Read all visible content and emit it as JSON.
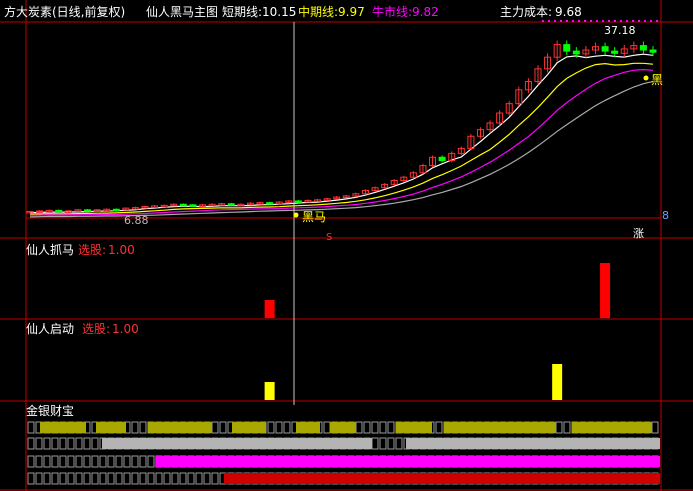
{
  "header": {
    "title": "方大炭素(日线,前复权)",
    "indicator": "仙人黑马主图",
    "short_label": "短期线:",
    "short_value": "10.15",
    "mid_label": "中期线:",
    "mid_value": "9.97",
    "bull_label": "牛市线:",
    "bull_value": "9.82",
    "main_cost_label": "主力成本:",
    "main_cost_value": "9.68"
  },
  "main_panel": {
    "high_label": "37.18",
    "low_label": "6.88",
    "marker_heima_cursor": "黑马",
    "marker_heima_right": "黑",
    "marker_s": "S",
    "marker_zhang": "涨",
    "right_value": "8"
  },
  "panel_zhuama": {
    "name": "仙人抓马",
    "signal_label": "选股:",
    "signal_value": "1.00"
  },
  "panel_qidong": {
    "name": "仙人启动",
    "signal_label": "选股:",
    "signal_value": "1.00"
  },
  "panel_jinyin": {
    "name": "金银财宝"
  },
  "colors": {
    "background": "#000000",
    "up_candle": "#ff3232",
    "down_candle": "#00ff00",
    "short_line": "#ffffff",
    "mid_line": "#ffff00",
    "bull_line": "#ff00ff",
    "cost_line": "#aaaaaa",
    "frame": "#c00000",
    "zhuama_bar": "#ff0000",
    "qidong_bar": "#ffff00",
    "gold_strip": "#a8a800",
    "silver_strip": "#b4b4b4",
    "magenta_strip": "#ff00ff",
    "red_strip": "#d00000"
  },
  "chart_data": [
    {
      "type": "line",
      "title": "仙人黑马主图",
      "series": [
        {
          "name": "短期线",
          "color": "#ffffff",
          "last": 10.15
        },
        {
          "name": "中期线",
          "color": "#ffff00",
          "last": 9.97
        },
        {
          "name": "牛市线",
          "color": "#ff00ff",
          "last": 9.82
        },
        {
          "name": "主力成本",
          "color": "#aaaaaa",
          "last": 9.68
        }
      ],
      "x": [
        0,
        2,
        4,
        6,
        8,
        10,
        12,
        14,
        16,
        18,
        20,
        22,
        24,
        26,
        28,
        30,
        32,
        34,
        36,
        38,
        40,
        42,
        44,
        46,
        48,
        50,
        52,
        54,
        56,
        58,
        60,
        62,
        64,
        66,
        68,
        70,
        72,
        74,
        76,
        78,
        80,
        82,
        84,
        86,
        88,
        90,
        92,
        94,
        96,
        98,
        100,
        102,
        104,
        106,
        108,
        110,
        112,
        114,
        116,
        118,
        120,
        122,
        124,
        126,
        128,
        130
      ],
      "close": [
        7.0,
        7.1,
        7.2,
        7.0,
        7.1,
        7.3,
        7.2,
        7.3,
        7.4,
        7.3,
        7.6,
        7.7,
        7.9,
        8.0,
        8.1,
        8.3,
        8.2,
        8.0,
        8.2,
        8.3,
        8.4,
        8.2,
        8.3,
        8.5,
        8.6,
        8.4,
        8.7,
        8.9,
        8.8,
        9.0,
        9.1,
        9.3,
        9.6,
        9.8,
        10.2,
        10.8,
        11.3,
        11.9,
        12.6,
        13.2,
        14.0,
        15.3,
        16.8,
        16.2,
        17.5,
        18.4,
        20.6,
        21.8,
        23.0,
        24.8,
        26.5,
        29.0,
        30.5,
        32.8,
        34.9,
        37.18,
        36.0,
        35.5,
        36.2,
        36.8,
        36.0,
        35.6,
        36.4,
        37.0,
        36.2,
        35.8
      ],
      "ylim": [
        6.0,
        40.0
      ],
      "price_labels": {
        "high": 37.18,
        "low": 6.88
      }
    },
    {
      "type": "bar",
      "title": "仙人抓马",
      "signals": [
        {
          "x": 50,
          "value": 1.0
        },
        {
          "x": 120,
          "value": 1.0
        }
      ]
    },
    {
      "type": "bar",
      "title": "仙人启动",
      "signals": [
        {
          "x": 50,
          "value": 1.0
        },
        {
          "x": 110,
          "value": 1.0
        }
      ]
    }
  ]
}
